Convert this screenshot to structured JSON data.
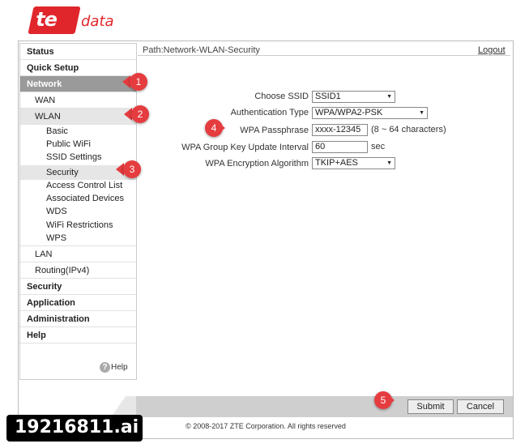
{
  "logo": {
    "te": "te",
    "data": "data"
  },
  "sidebar": {
    "items": [
      {
        "label": "Status"
      },
      {
        "label": "Quick Setup"
      },
      {
        "label": "Network"
      },
      {
        "label": "WAN"
      },
      {
        "label": "WLAN"
      },
      {
        "label": "Basic"
      },
      {
        "label": "Public WiFi"
      },
      {
        "label": "SSID Settings"
      },
      {
        "label": "Security"
      },
      {
        "label": "Access Control List"
      },
      {
        "label": "Associated Devices"
      },
      {
        "label": "WDS"
      },
      {
        "label": "WiFi Restrictions"
      },
      {
        "label": "WPS"
      },
      {
        "label": "LAN"
      },
      {
        "label": "Routing(IPv4)"
      },
      {
        "label": "Security"
      },
      {
        "label": "Application"
      },
      {
        "label": "Administration"
      },
      {
        "label": "Help"
      }
    ],
    "help": "Help",
    "help_icon": "?"
  },
  "header": {
    "path": "Path:Network-WLAN-Security",
    "logout": "Logout"
  },
  "form": {
    "ssid": {
      "label": "Choose SSID",
      "value": "SSID1"
    },
    "auth": {
      "label": "Authentication Type",
      "value": "WPA/WPA2-PSK"
    },
    "passphrase": {
      "label": "WPA Passphrase",
      "value": "xxxx-12345",
      "hint": "(8 ~ 64 characters)"
    },
    "group_key": {
      "label": "WPA Group Key Update Interval",
      "value": "60",
      "unit": "sec"
    },
    "encryption": {
      "label": "WPA Encryption Algorithm",
      "value": "TKIP+AES"
    }
  },
  "buttons": {
    "submit": "Submit",
    "cancel": "Cancel"
  },
  "footer": {
    "copyright": "© 2008-2017 ZTE Corporation. All rights reserved"
  },
  "annotations": [
    "1",
    "2",
    "3",
    "4",
    "5"
  ],
  "watermark": "19216811.ai",
  "colors": {
    "brand": "#e0262b",
    "badge": "#e53c3f",
    "active_nav": "#9a9a9a"
  }
}
